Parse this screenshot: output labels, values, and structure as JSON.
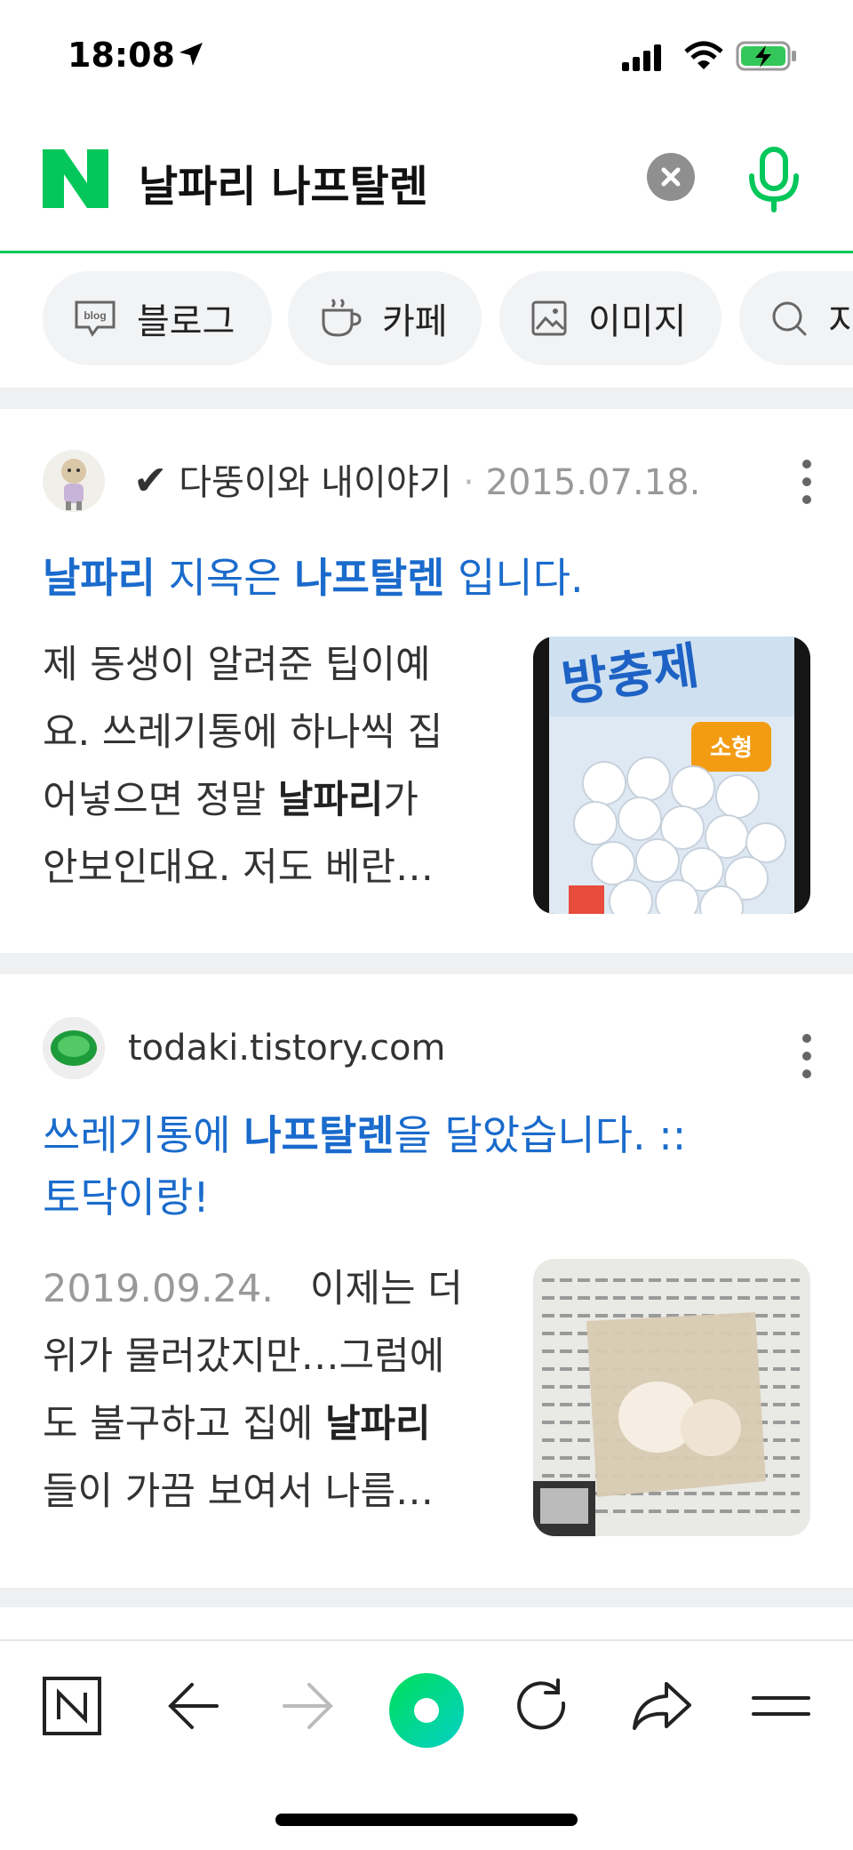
{
  "status_bar": {
    "time": "18:08",
    "icons": [
      "location-arrow-icon",
      "signal-icon",
      "wifi-icon",
      "battery-charging-icon"
    ]
  },
  "search": {
    "logo": "N",
    "query": "날파리 나프탈렌",
    "clear_icon": "close-icon",
    "mic_icon": "microphone-icon"
  },
  "colors": {
    "brand_green": "#03c75a",
    "link_blue": "#1a6bcc",
    "chip_bg": "#f2f3f5"
  },
  "filters": [
    {
      "label": "블로그",
      "icon": "blog-icon"
    },
    {
      "label": "카페",
      "icon": "cafe-cup-icon"
    },
    {
      "label": "이미지",
      "icon": "image-icon"
    },
    {
      "label": "지",
      "icon": "search-icon"
    }
  ],
  "results": [
    {
      "author": "다뚱이와 내이야기",
      "checkmark": "✔",
      "separator": "·",
      "date": "2015.07.18.",
      "title_parts": [
        "날파리",
        " 지옥은 ",
        "나프탈렌",
        " 입니다."
      ],
      "snippet_line1": "제 동생이 알려준 팁이예",
      "snippet_line2": "요. 쓰레기통에 하나씩 집",
      "snippet_line3_pre": "어넣으면 정말 ",
      "snippet_line3_bold": "날파리",
      "snippet_line3_post": "가",
      "snippet_line4": "안보인대요. 저도 베란…",
      "thumb_text": "방충제",
      "thumb_badge": "소형"
    },
    {
      "source": "todaki.tistory.com",
      "title_line1_pre": "쓰레기통에 ",
      "title_line1_bold": "나프탈렌",
      "title_line1_post": "을 달았습니다. ::",
      "title_line2": "토닥이랑!",
      "date": "2019.09.24.",
      "snippet_line1": "이제는 더",
      "snippet_line2": "위가 물러갔지만…그럼에",
      "snippet_line3_pre": "도 불구하고 집에 ",
      "snippet_line3_bold": "날파리",
      "snippet_line4": "들이 가끔 보여서 나름…"
    }
  ],
  "toolbar": {
    "items": [
      "naver-home-icon",
      "back-arrow-icon",
      "forward-arrow-icon",
      "green-dot-icon",
      "refresh-icon",
      "share-icon",
      "menu-icon"
    ],
    "home_label": "N"
  }
}
